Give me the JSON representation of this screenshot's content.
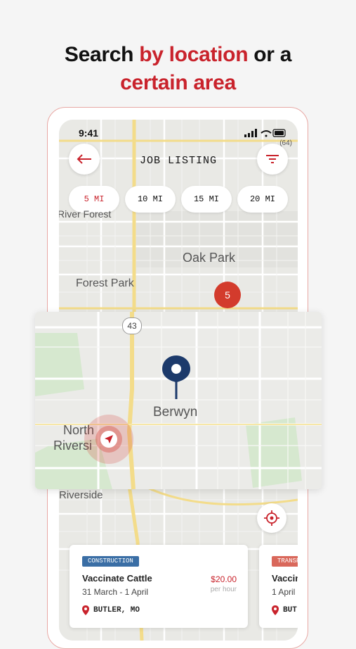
{
  "headline": {
    "part1": "Search ",
    "accent1": "by location",
    "part2": " or a",
    "accent2": "certain area"
  },
  "status": {
    "time": "9:41"
  },
  "header": {
    "title": "JOB LISTING",
    "back_icon": "back-arrow-icon",
    "filter_icon": "filter-icon"
  },
  "radius_chips": [
    {
      "label": "5 MI",
      "active": true
    },
    {
      "label": "10 MI",
      "active": false
    },
    {
      "label": "15 MI",
      "active": false
    },
    {
      "label": "20 MI",
      "active": false
    }
  ],
  "map": {
    "labels": {
      "river_forest": "River Forest",
      "oak_park": "Oak Park",
      "forest_park": "Forest Park",
      "highway": "43",
      "riverside": "Riverside",
      "route_64": "(64)"
    },
    "cluster_count": "5"
  },
  "zoom_map": {
    "labels": {
      "berwyn": "Berwyn",
      "north": "North",
      "riverside": "Riversi"
    }
  },
  "jobs": [
    {
      "category": "CONSTRUCTION",
      "category_color": "#3a6ea5",
      "title": "Vaccinate Cattle",
      "dates": "31 March - 1 April",
      "price": "$20.00",
      "per": "per hour",
      "location": "BUTLER, MO"
    },
    {
      "category": "TRANSP",
      "category_color": "#d9685b",
      "title": "Vaccin",
      "dates": "1 April",
      "location": "BUT"
    }
  ],
  "colors": {
    "accent": "#c9232c",
    "pin": "#1c3a6b",
    "cluster": "#d33b2c"
  }
}
